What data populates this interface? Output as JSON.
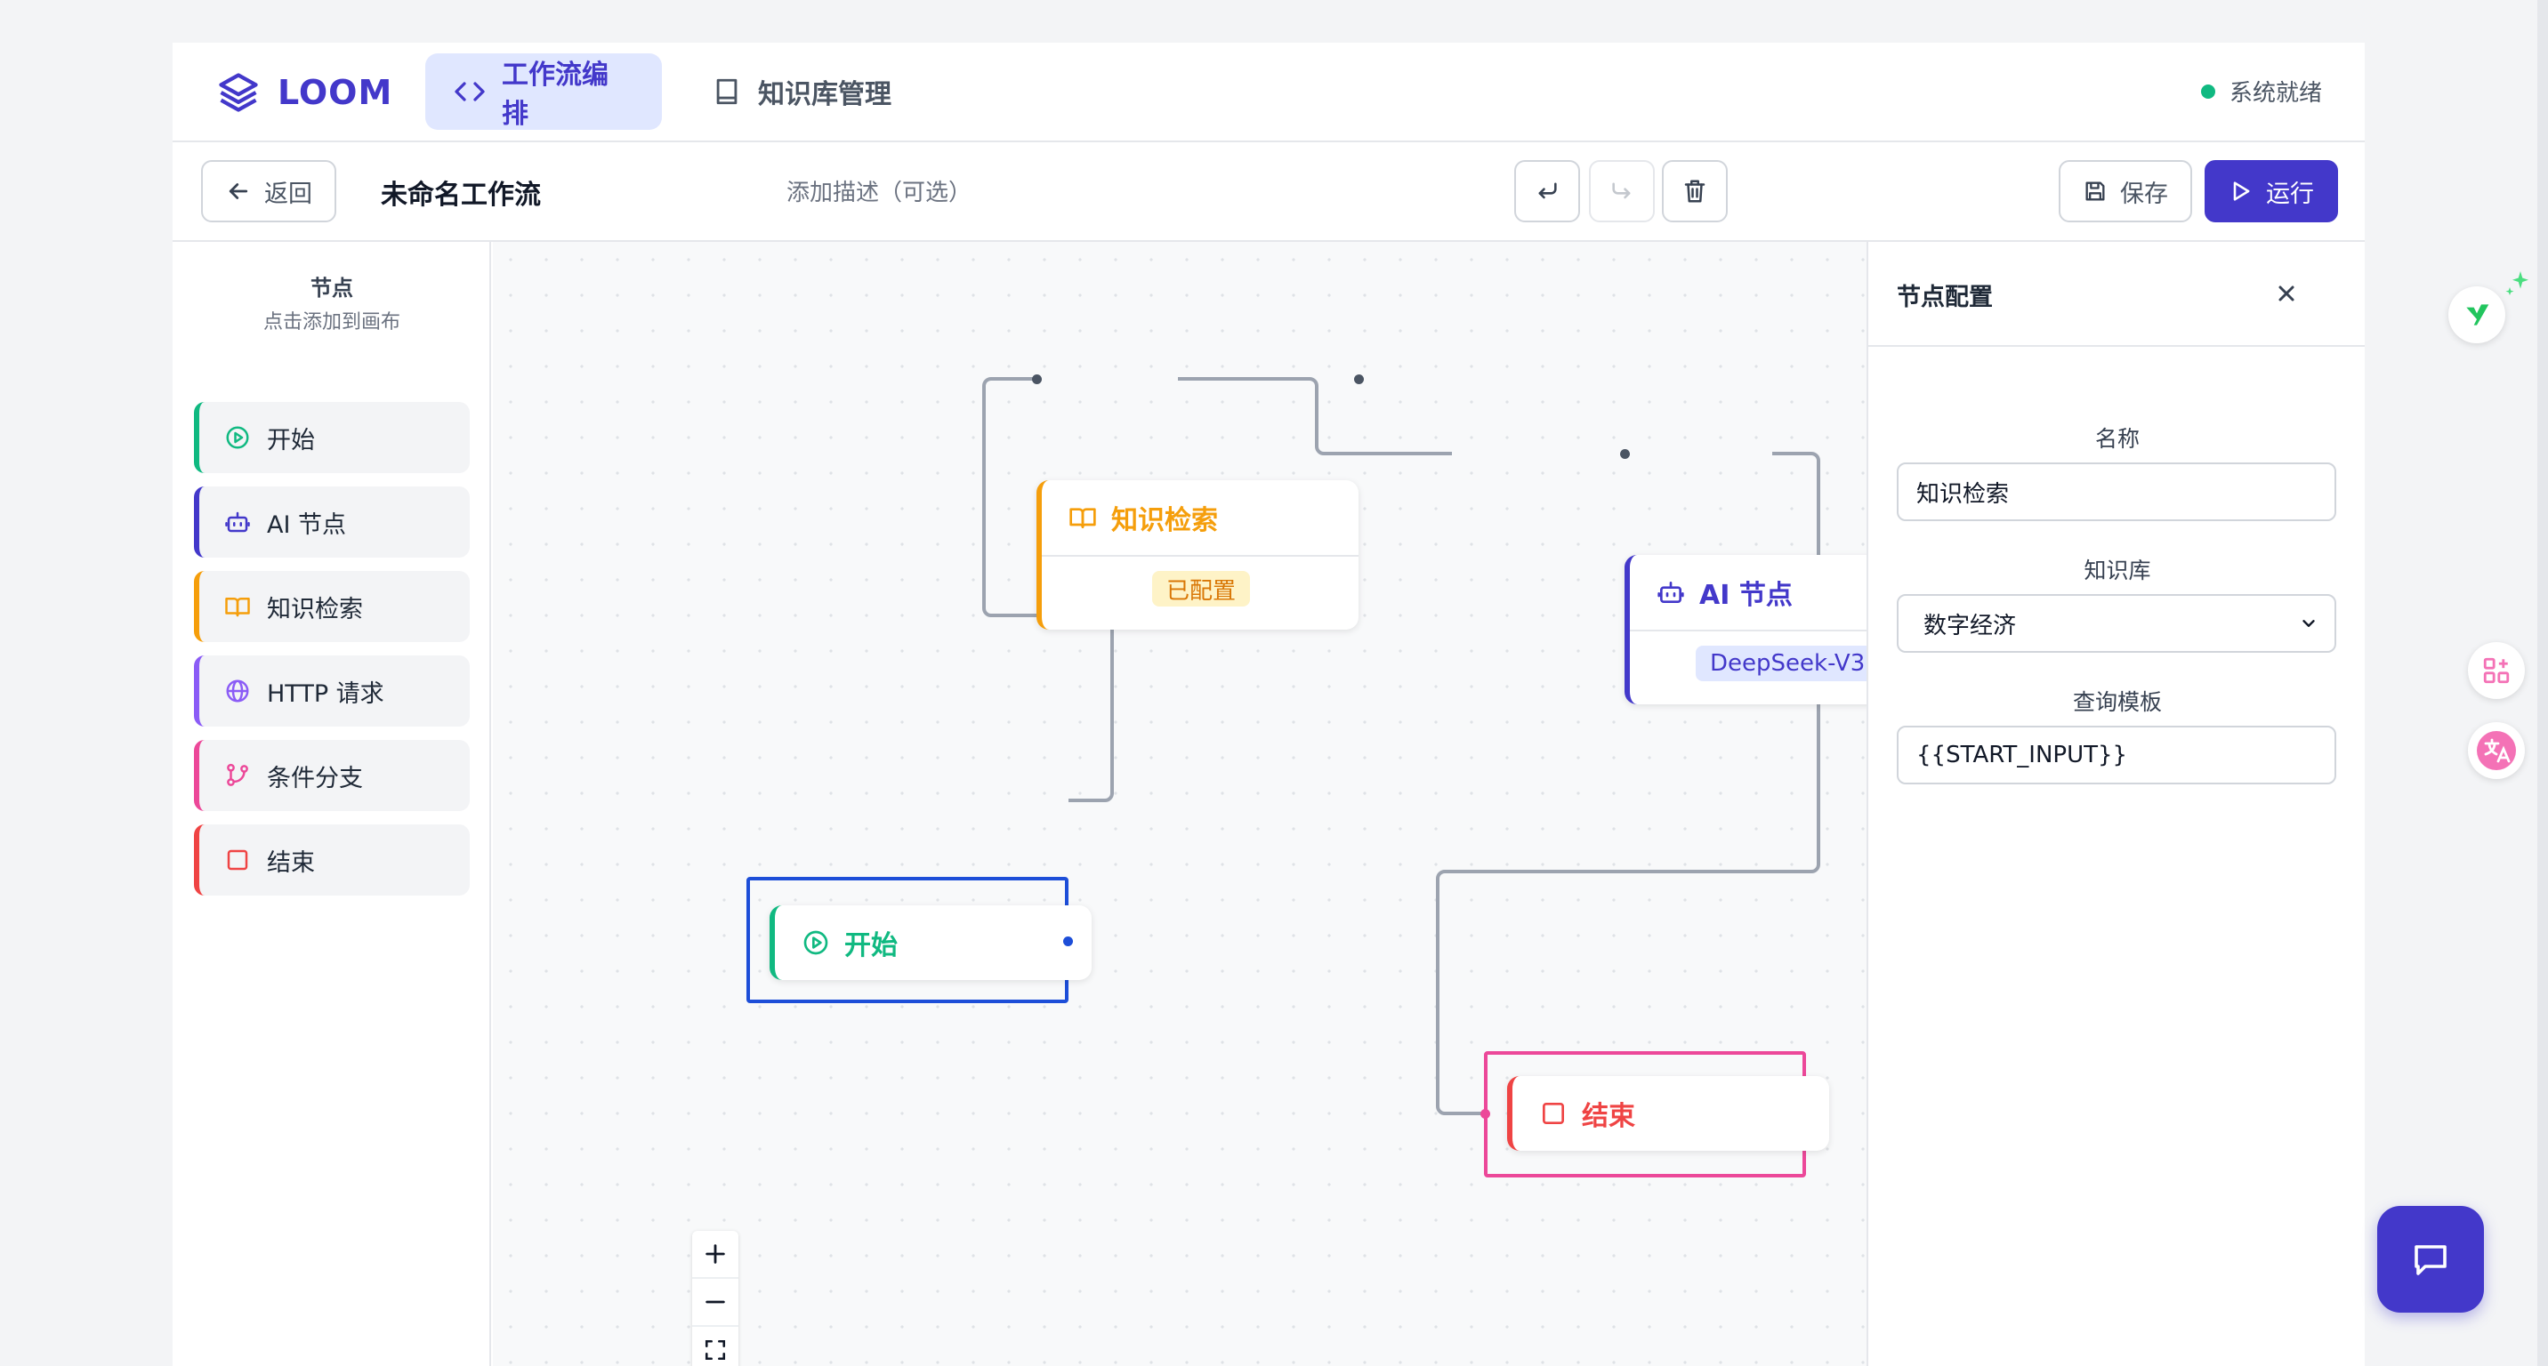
{
  "app": {
    "logo_text": "LOOM"
  },
  "nav": {
    "tabs": [
      {
        "label": "工作流编排",
        "icon": "code-icon",
        "active": true
      },
      {
        "label": "知识库管理",
        "icon": "book-icon",
        "active": false
      }
    ],
    "status_text": "系统就绪",
    "status_color": "#10b981"
  },
  "toolbar": {
    "back_label": "返回",
    "workflow_title": "未命名工作流",
    "description_placeholder": "添加描述（可选）",
    "save_label": "保存",
    "run_label": "运行"
  },
  "sidebar": {
    "title": "节点",
    "subtitle": "点击添加到画布",
    "items": [
      {
        "label": "开始",
        "icon": "play-circle-icon",
        "color": "#10b981"
      },
      {
        "label": "AI 节点",
        "icon": "bot-icon",
        "color": "#4338ca"
      },
      {
        "label": "知识检索",
        "icon": "book-open-icon",
        "color": "#f59e0b"
      },
      {
        "label": "HTTP 请求",
        "icon": "globe-icon",
        "color": "#8b5cf6"
      },
      {
        "label": "条件分支",
        "icon": "branch-icon",
        "color": "#ec4899"
      },
      {
        "label": "结束",
        "icon": "square-icon",
        "color": "#ef4444"
      }
    ]
  },
  "canvas": {
    "nodes": {
      "knowledge": {
        "title": "知识检索",
        "tag": "已配置",
        "color": "#f59e0b"
      },
      "ai": {
        "title": "AI 节点",
        "tag": "DeepSeek-V3",
        "color": "#4338ca"
      },
      "start": {
        "title": "开始",
        "color": "#10b981"
      },
      "end": {
        "title": "结束",
        "color": "#ef4444"
      }
    }
  },
  "config": {
    "title": "节点配置",
    "fields": {
      "name_label": "名称",
      "name_value": "知识检索",
      "kb_label": "知识库",
      "kb_value": "数字经济",
      "query_label": "查询模板",
      "query_value": "{{START_INPUT}}"
    }
  },
  "colors": {
    "accent": "#4338ca"
  }
}
